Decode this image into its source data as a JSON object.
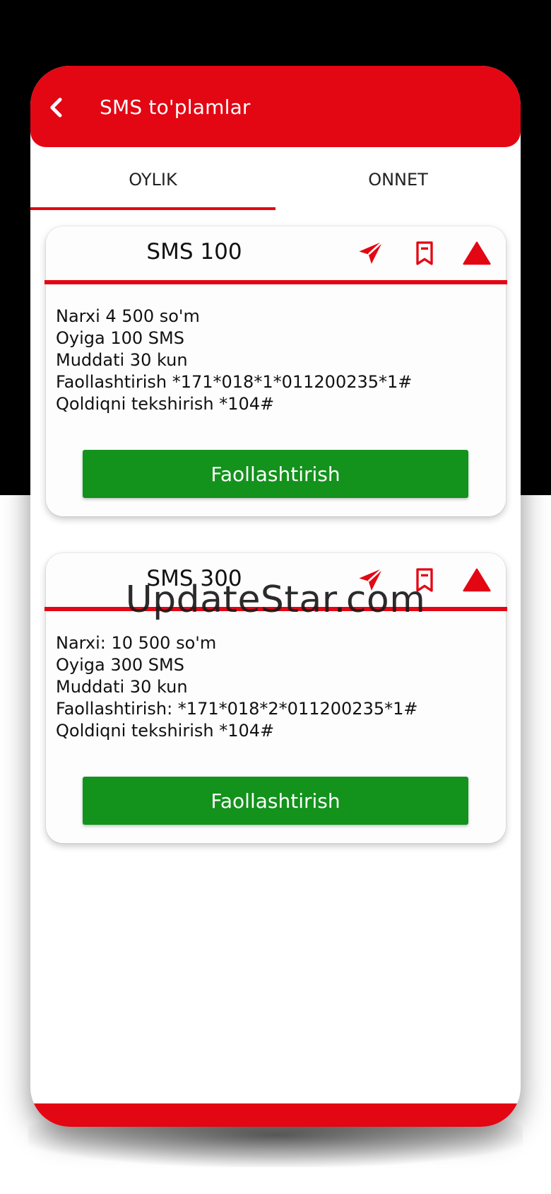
{
  "appbar": {
    "title": "SMS to'plamlar"
  },
  "tabs": [
    {
      "label": "OYLIK",
      "active": true
    },
    {
      "label": "ONNET",
      "active": false
    }
  ],
  "cards": [
    {
      "title": "SMS 100",
      "lines": [
        "Narxi 4 500 so'm",
        "Oyiga 100 SMS",
        "Muddati 30 kun",
        "Faollashtirish *171*018*1*011200235*1#",
        "Qoldiqni tekshirish *104#"
      ],
      "button_label": "Faollashtirish"
    },
    {
      "title": "SMS 300",
      "lines": [
        "Narxi: 10 500 so'm",
        "Oyiga 300 SMS",
        "Muddati 30 kun",
        "Faollashtirish: *171*018*2*011200235*1#",
        "Qoldiqni tekshirish *104#"
      ],
      "button_label": "Faollashtirish"
    }
  ],
  "watermark": "UpdateStar.com",
  "colors": {
    "brand_red": "#e30613",
    "action_green": "#13921c"
  },
  "icons": {
    "back": "chevron-left-icon",
    "send": "send-icon",
    "bookmark": "bookmark-icon",
    "collapse": "triangle-up-icon"
  }
}
